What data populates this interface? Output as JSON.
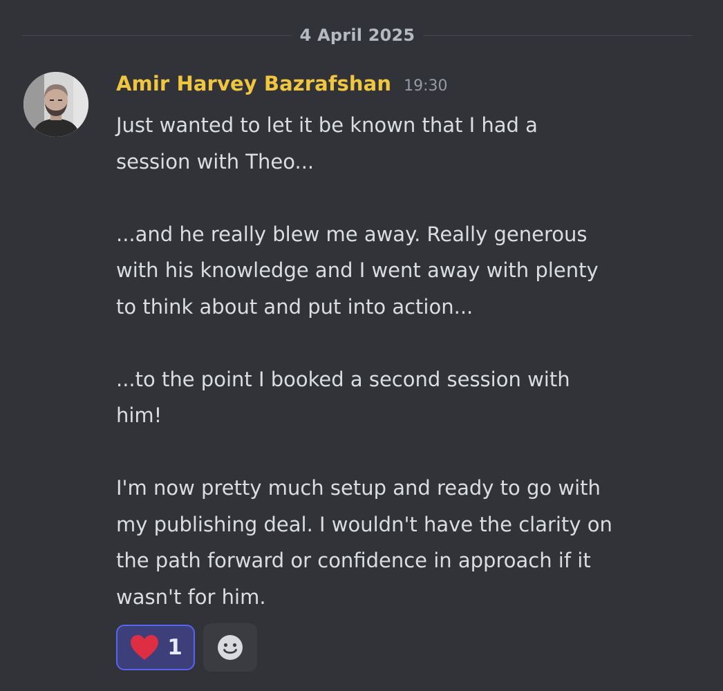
{
  "divider": {
    "date": "4 April 2025"
  },
  "message": {
    "author": {
      "name": "Amir Harvey Bazrafshan",
      "name_color": "#f0c640",
      "avatar_icon": "avatar-photo"
    },
    "timestamp": "19:30",
    "paragraphs": [
      "Just wanted to let it be known that I had a\nsession with Theo...",
      "...and he really blew me away. Really generous\nwith his knowledge and I went away with plenty\nto think about and put into action...",
      "...to the point I booked a second session with\nhim!",
      "I'm now pretty much setup and ready to go with\nmy publishing deal. I wouldn't have the clarity on\nthe path forward or confidence in approach if it\nwasn't for him."
    ],
    "reactions": [
      {
        "emoji": "heart-icon",
        "count": "1",
        "active": true,
        "highlight_color": "#5865f2"
      }
    ],
    "add_reaction_icon": "smiley-icon"
  }
}
